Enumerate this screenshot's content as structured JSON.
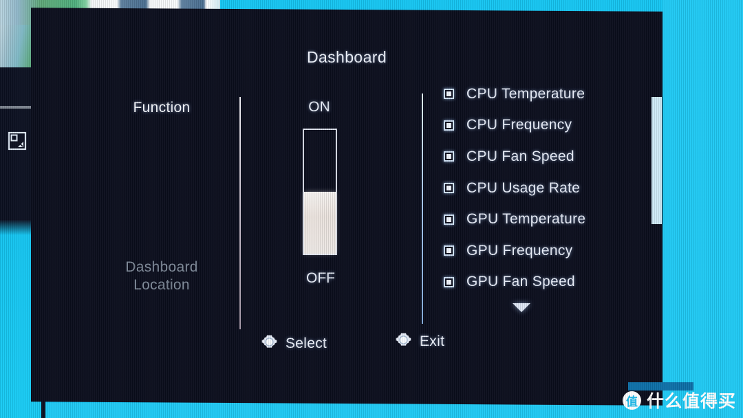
{
  "osd": {
    "title": "Dashboard",
    "function_column": {
      "items": [
        {
          "label": "Function",
          "state": "selected"
        },
        {
          "label": "Dashboard\nLocation",
          "state": "dimmed"
        }
      ],
      "function_label": "Function",
      "dashboard_location_line1": "Dashboard",
      "dashboard_location_line2": "Location"
    },
    "toggle": {
      "on_label": "ON",
      "off_label": "OFF",
      "value": "OFF",
      "fill_percent": 50
    },
    "checklist": {
      "items": [
        {
          "label": "CPU Temperature",
          "checked": true
        },
        {
          "label": "CPU Frequency",
          "checked": true
        },
        {
          "label": "CPU Fan Speed",
          "checked": true
        },
        {
          "label": "CPU Usage Rate",
          "checked": true
        },
        {
          "label": "GPU Temperature",
          "checked": true
        },
        {
          "label": "GPU Frequency",
          "checked": true
        },
        {
          "label": "GPU Fan Speed",
          "checked": true
        }
      ],
      "more_indicator": "scroll-down-arrow"
    },
    "footer": {
      "select_label": "Select",
      "exit_label": "Exit",
      "select_icon": "dpad-icon",
      "exit_icon": "dpad-icon"
    }
  },
  "desktop": {
    "left_icon": "screen-snip-icon",
    "background_color": "#1fc9f4"
  },
  "watermark": {
    "badge": "值",
    "text": "什么值得买"
  }
}
